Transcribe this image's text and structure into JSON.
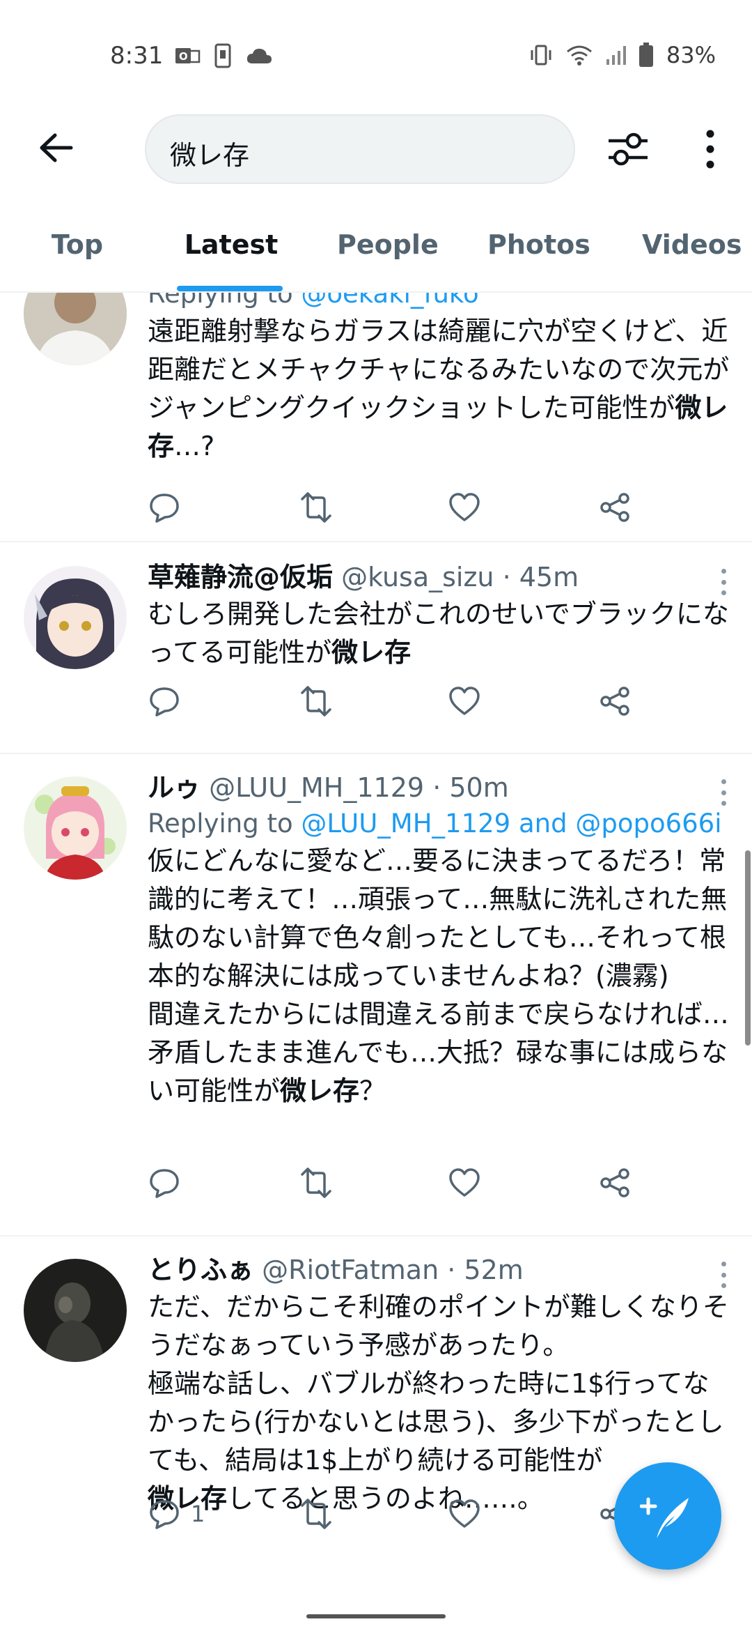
{
  "status_bar": {
    "time": "8:31",
    "battery": "83%",
    "icons": [
      "outlook-icon",
      "phone-icon",
      "cloud-icon",
      "vibrate-icon",
      "wifi-icon",
      "signal-icon",
      "battery-icon"
    ]
  },
  "search": {
    "query": "微レ存"
  },
  "tabs": [
    {
      "label": "Top",
      "active": false
    },
    {
      "label": "Latest",
      "active": true
    },
    {
      "label": "People",
      "active": false
    },
    {
      "label": "Photos",
      "active": false
    },
    {
      "label": "Videos",
      "active": false
    }
  ],
  "tweets": [
    {
      "reply_prefix": "Replying to ",
      "reply_to": "@oekaki_fuko",
      "text_parts": [
        "遠距離射撃ならガラスは綺麗に穴が空くけど、近距離だとメチャクチャになるみたいなので次元がジャンピングクイックショットした可能性が",
        "微レ存",
        "…?"
      ]
    },
    {
      "name": "草薙静流@仮垢",
      "handle": "@kusa_sizu",
      "time": "· 45m",
      "text_parts": [
        "むしろ開発した会社がこれのせいでブラックになってる可能性が",
        "微レ存",
        ""
      ]
    },
    {
      "name": "ルゥ",
      "handle": "@LUU_MH_1129",
      "time": "· 50m",
      "reply_prefix": "Replying to ",
      "reply_to": "@LUU_MH_1129 and @popo666i",
      "text_parts": [
        "仮にどんなに愛など…要るに決まってるだろ！常識的に考えて！…頑張って…無駄に洗礼された無駄のない計算で色々創ったとしても…それって根本的な解決には成っていませんよね？(濃霧)\n間違えたからには間違える前まで戻らなければ…矛盾したまま進んでも…大抵？碌な事には成らない可能性が",
        "微レ存",
        "？"
      ]
    },
    {
      "name": "とりふぁ",
      "handle": "@RiotFatman",
      "time": "· 52m",
      "text_parts": [
        "ただ、だからこそ利確のポイントが難しくなりそうだなぁっていう予感があったり。\n極端な話し、バブルが終わった時に1$行ってなかったら(行かないとは思う)、多少下がったとしても、結局は1$上がり続ける可能性が\n",
        "微レ存",
        "してると思うのよね……。"
      ],
      "reply_count": "1"
    }
  ]
}
